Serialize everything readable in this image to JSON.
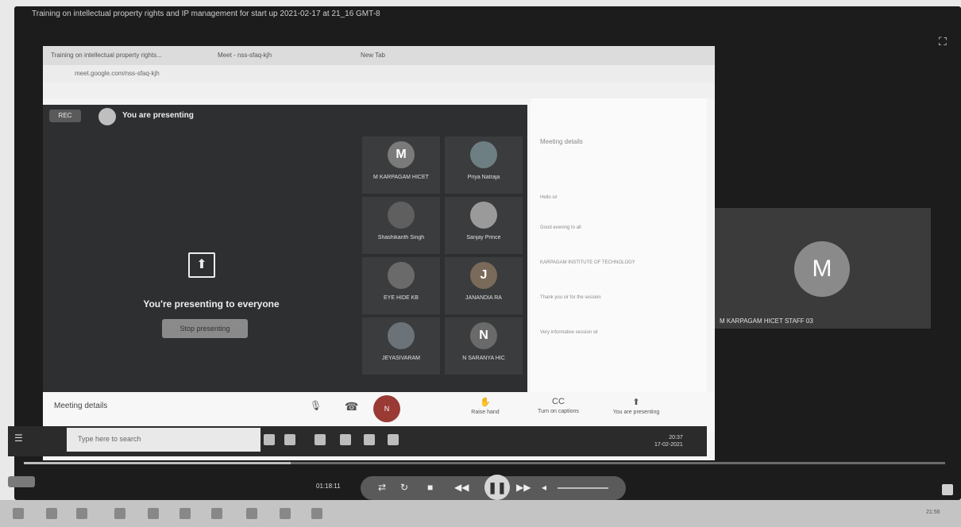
{
  "player": {
    "title": "Training on intellectual property rights and IP management for start up 2021-02-17 at 21_16 GMT-8",
    "time": "01:18:11"
  },
  "browser": {
    "tabs": [
      "Training on intellectual property rights...",
      "Meet - nss-sfaq-kjh",
      "New Tab"
    ],
    "url": "meet.google.com/nss-sfaq-kjh"
  },
  "meet": {
    "rec_label": "REC",
    "presenting_label": "You are presenting",
    "present_text": "You're presenting to everyone",
    "stop_label": "Stop presenting",
    "meeting_details": "Meeting details",
    "self_initials": "N",
    "participants": [
      {
        "initial": "M",
        "name": "M KARPAGAM HICET",
        "color": "#7a7a7a"
      },
      {
        "initial": "",
        "name": "Priya Natraja",
        "color": "#6e7f84"
      },
      {
        "initial": "",
        "name": "Shashikanth Singh",
        "color": "#5f5f5f"
      },
      {
        "initial": "",
        "name": "Sanjay Prince",
        "color": "#9a9a9a"
      },
      {
        "initial": "",
        "name": "EYE HIDE KB",
        "color": "#6a6a6a"
      },
      {
        "initial": "J",
        "name": "JANANDIA RA",
        "color": "#7a6a5a"
      },
      {
        "initial": "",
        "name": "JEYASIVARAM",
        "color": "#6c7378"
      },
      {
        "initial": "N",
        "name": "N SARANYA HIC",
        "color": "#6a6a6a"
      }
    ],
    "bar_buttons": [
      {
        "icon": "✋",
        "label": "Raise hand"
      },
      {
        "icon": "CC",
        "label": "Turn on captions"
      },
      {
        "icon": "⬆",
        "label": "You are presenting"
      }
    ]
  },
  "chat": {
    "title": "Meeting details",
    "messages": [
      "Hello sir",
      "Good evening to all",
      "KARPAGAM INSTITUTE OF TECHNOLOGY",
      "Thank you sir for the session",
      "Very informative session sir"
    ]
  },
  "inner_taskbar": {
    "search_placeholder": "Type here to search",
    "clock_time": "20:37",
    "clock_date": "17-02-2021"
  },
  "m_tile": {
    "initial": "M",
    "name": "M KARPAGAM HICET STAFF 03"
  },
  "progress": {
    "fraction": 0.29
  },
  "host_clock": "21:56"
}
